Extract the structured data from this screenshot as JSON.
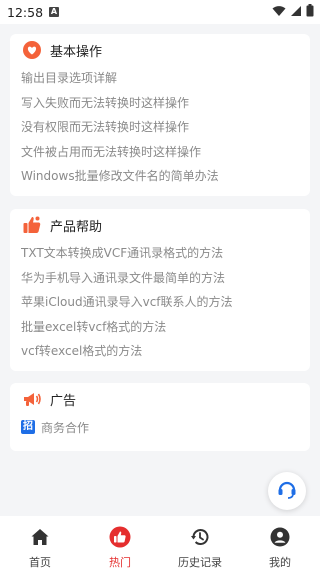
{
  "status_bar": {
    "time": "12:58",
    "notif_letter": "A"
  },
  "cards": {
    "basic": {
      "title": "基本操作",
      "items": [
        "输出目录选项详解",
        "写入失败而无法转换时这样操作",
        "没有权限而无法转换时这样操作",
        "文件被占用而无法转换时这样操作",
        "Windows批量修改文件名的简单办法"
      ]
    },
    "help": {
      "title": "产品帮助",
      "items": [
        "TXT文本转换成VCF通讯录格式的方法",
        "华为手机导入通讯录文件最简单的方法",
        "苹果iCloud通讯录导入vcf联系人的方法",
        "批量excel转vcf格式的方法",
        "vcf转excel格式的方法"
      ]
    },
    "ad": {
      "title": "广告",
      "badge": "招",
      "item": "商务合作"
    }
  },
  "bottom_nav": [
    {
      "label": "首页",
      "icon": "home-icon",
      "active": false
    },
    {
      "label": "热门",
      "icon": "thumbs-up-icon",
      "active": true
    },
    {
      "label": "历史记录",
      "icon": "history-icon",
      "active": false
    },
    {
      "label": "我的",
      "icon": "profile-icon",
      "active": false
    }
  ],
  "colors": {
    "accent": "#e52e2e",
    "orange": "#f4623a",
    "blue": "#1e6ee6",
    "muted_text": "#8a8a8a"
  }
}
